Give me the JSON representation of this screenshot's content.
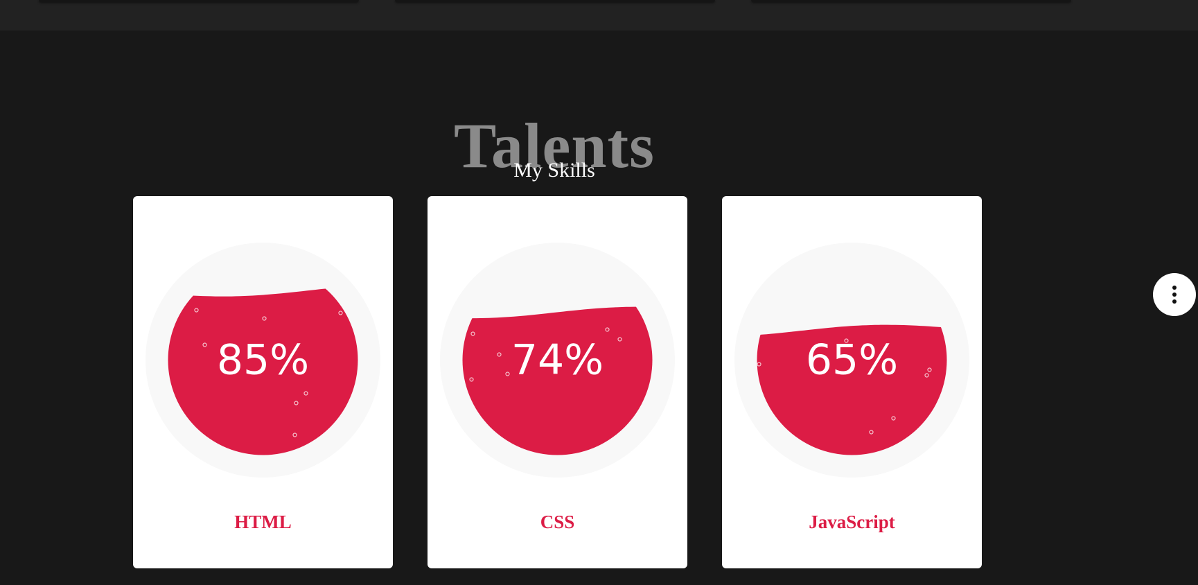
{
  "section": {
    "title": "Talents",
    "subtitle": "My Skills"
  },
  "skills": [
    {
      "name": "HTML",
      "percent_label": "85%",
      "level": 0.85
    },
    {
      "name": "CSS",
      "percent_label": "74%",
      "level": 0.74
    },
    {
      "name": "JavaScript",
      "percent_label": "65%",
      "level": 0.65
    }
  ],
  "colors": {
    "page_background": "#181818",
    "liquid": "#dc1c45",
    "card": "#ffffff",
    "skill_label": "#dc1c45",
    "title": "#8a8a8a"
  },
  "icons": {
    "menu": "more-vertical-icon"
  }
}
